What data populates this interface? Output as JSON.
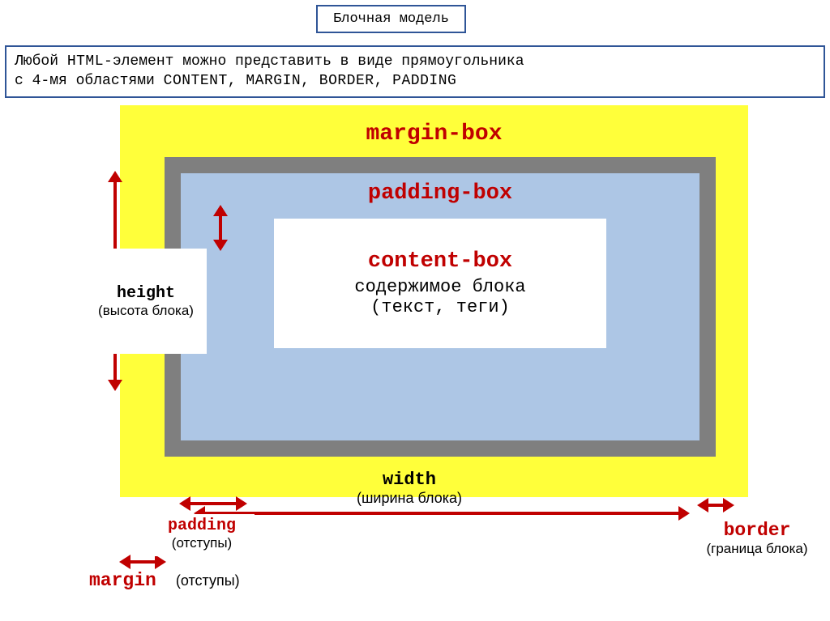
{
  "title": "Блочная модель",
  "description": {
    "line1_prefix": "Любой ",
    "line1_kw": "HTML",
    "line1_suffix": "-элемент можно представить в виде прямоугольника",
    "line2_prefix": "с 4-мя областями  ",
    "areas": "content,  margin, border, padding"
  },
  "labels": {
    "margin_box": "margin-box",
    "padding_box": "padding-box",
    "content_box_title": "content-box",
    "content_box_line1": "содержимое блока",
    "content_box_line2": "(текст, теги)",
    "height": "height",
    "height_sub": "(высота блока)",
    "width": "width",
    "width_sub": "(ширина блока)",
    "padding": "padding",
    "padding_sub": "(отступы)",
    "border": "border",
    "border_sub": "(граница блока)",
    "margin": "margin",
    "margin_sub": "(отступы)"
  },
  "colors": {
    "frame": "#2f5597",
    "keyword": "#c00000",
    "margin_fill": "#ffff3a",
    "border_fill": "#7f7f7f",
    "padding_fill": "#adc6e5",
    "content_fill": "#ffffff"
  }
}
